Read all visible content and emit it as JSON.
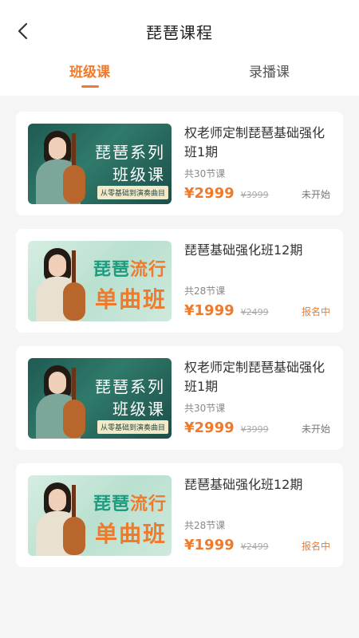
{
  "header": {
    "title": "琵琶课程",
    "back_icon": "chevron-left-icon"
  },
  "tabs": [
    {
      "label": "班级课",
      "active": true
    },
    {
      "label": "录播课",
      "active": false
    }
  ],
  "accent_color": "#f07a2b",
  "courses": [
    {
      "thumb": {
        "style": "green",
        "line1": "琵琶系列",
        "line2": "班级课",
        "line3": "从零基础到演奏曲目"
      },
      "name": "权老师定制琵琶基础强化班1期",
      "lessons": "共30节课",
      "price": "¥2999",
      "original_price": "¥3999",
      "status": "未开始"
    },
    {
      "thumb": {
        "style": "mint",
        "line1a": "琵琶",
        "line1b": "流行",
        "line2": "单曲班"
      },
      "name": "琵琶基础强化班12期",
      "lessons": "共28节课",
      "price": "¥1999",
      "original_price": "¥2499",
      "status": "报名中"
    },
    {
      "thumb": {
        "style": "green",
        "line1": "琵琶系列",
        "line2": "班级课",
        "line3": "从零基础到演奏曲目"
      },
      "name": "权老师定制琵琶基础强化班1期",
      "lessons": "共30节课",
      "price": "¥2999",
      "original_price": "¥3999",
      "status": "未开始"
    },
    {
      "thumb": {
        "style": "mint",
        "line1a": "琵琶",
        "line1b": "流行",
        "line2": "单曲班"
      },
      "name": "琵琶基础强化班12期",
      "lessons": "共28节课",
      "price": "¥1999",
      "original_price": "¥2499",
      "status": "报名中"
    }
  ]
}
